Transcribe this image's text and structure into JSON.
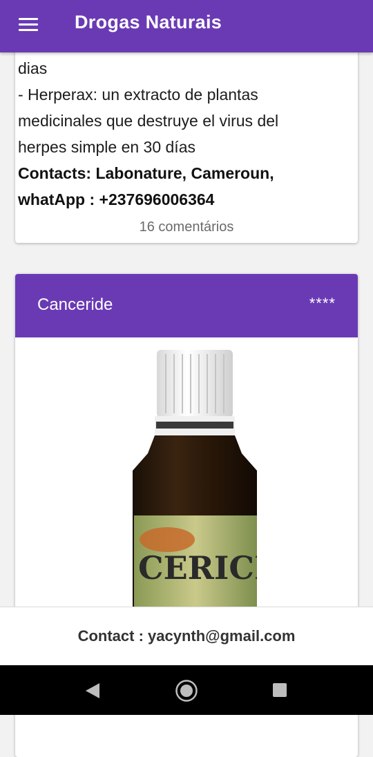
{
  "app": {
    "title": "Drogas Naturais"
  },
  "card1": {
    "lines": [
      "dias",
      "- Herperax: un extracto de plantas",
      "medicinales que destruye el virus del",
      "herpes simple en 30 días"
    ],
    "contact_lines": [
      "Contacts: Labonature, Cameroun,",
      "whatApp : +237696006364"
    ],
    "comments": "16 comentários"
  },
  "card2": {
    "title": "Canceride",
    "rating": "****",
    "label_text": "CERICID"
  },
  "footer": {
    "contact": "Contact : yacynth@gmail.com"
  },
  "colors": {
    "primary": "#6a3ab4"
  },
  "icons": {
    "menu": "hamburger-menu-icon",
    "back": "back-triangle-icon",
    "home": "home-circle-icon",
    "recent": "recent-apps-square-icon"
  }
}
